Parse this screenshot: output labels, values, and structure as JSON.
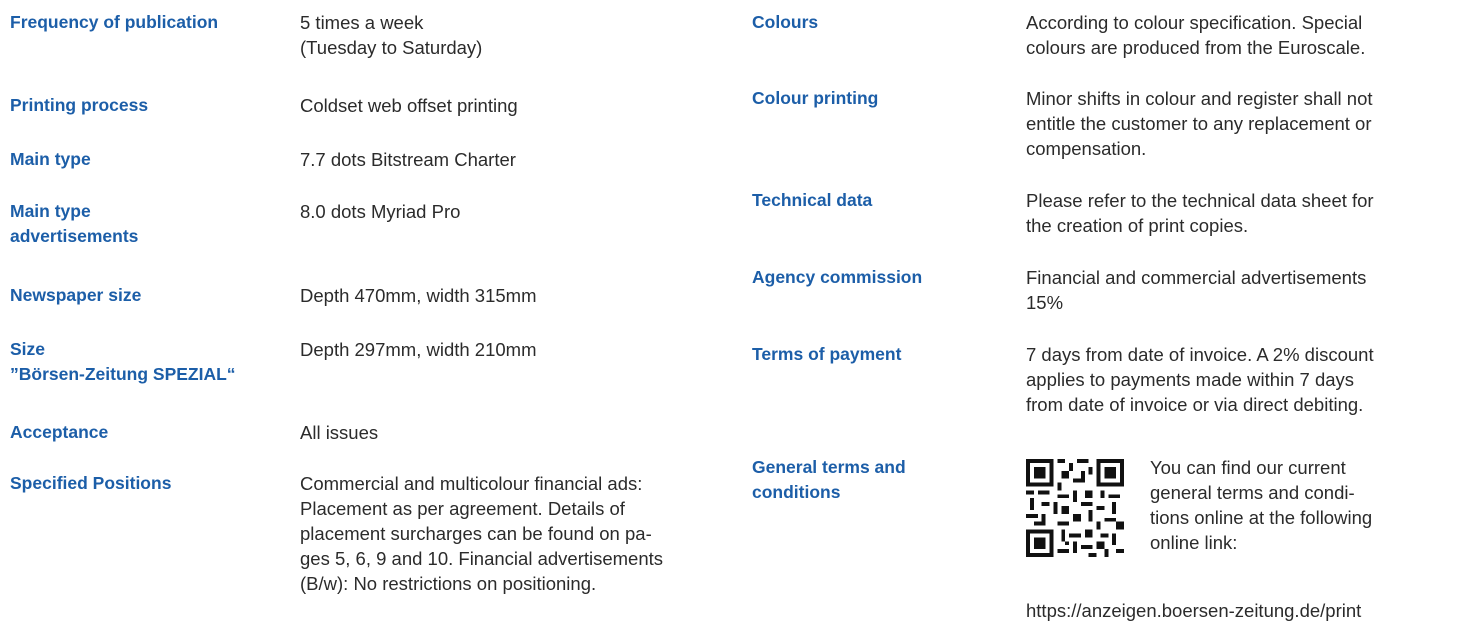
{
  "left_rows": [
    {
      "label": [
        "Frequency of publication"
      ],
      "value": [
        "5 times a week",
        "(Tuesday to Saturday)"
      ]
    },
    {
      "label": [
        "Printing process"
      ],
      "value": [
        "Coldset web offset printing"
      ]
    },
    {
      "label": [
        "Main type"
      ],
      "value": [
        "7.7 dots Bitstream Charter"
      ]
    },
    {
      "label": [
        "Main type",
        "advertisements"
      ],
      "value": [
        "8.0 dots Myriad Pro"
      ]
    },
    {
      "label": [
        "Newspaper size"
      ],
      "value": [
        "Depth 470mm, width 315mm"
      ]
    },
    {
      "label": [
        "Size",
        "”Börsen-Zeitung SPEZIAL“"
      ],
      "value": [
        "Depth 297mm, width 210mm"
      ]
    },
    {
      "label": [
        "Acceptance"
      ],
      "value": [
        "All issues"
      ]
    },
    {
      "label": [
        "Specified Positions"
      ],
      "value": [
        "Commercial and multicolour financial ads:",
        "Placement as per agreement. Details of",
        "placement surcharges can be found on pa-",
        "ges 5, 6, 9 and 10. Financial advertisements",
        "(B/w): No restrictions on positioning."
      ]
    }
  ],
  "right_rows": [
    {
      "label": [
        "Colours"
      ],
      "value": [
        "According to colour specification. Special",
        "colours are produced from the Euroscale."
      ]
    },
    {
      "label": [
        "Colour printing"
      ],
      "value": [
        "Minor shifts in colour and register shall not",
        "entitle the customer to any replacement or",
        "compensation."
      ]
    },
    {
      "label": [
        "Technical data"
      ],
      "value": [
        "Please refer to the technical data sheet for",
        "the creation of print copies."
      ]
    },
    {
      "label": [
        "Agency commission"
      ],
      "value": [
        "Financial and commercial advertisements",
        "15%"
      ]
    },
    {
      "label": [
        "Terms of payment"
      ],
      "value": [
        "7 days from date of invoice. A 2% discount",
        "applies to payments made within 7 days",
        "from date of invoice or via direct debiting."
      ]
    }
  ],
  "general_terms": {
    "label": [
      "General terms and",
      "conditions"
    ],
    "text": [
      "You can find our current",
      "general terms and condi-",
      "tions online at the following",
      "online link:"
    ],
    "url": "https://anzeigen.boersen-zeitung.de/print",
    "qr_icon": "qr-code-icon"
  },
  "colors": {
    "label": "#1c5ea8",
    "text": "#2b2b2b"
  }
}
